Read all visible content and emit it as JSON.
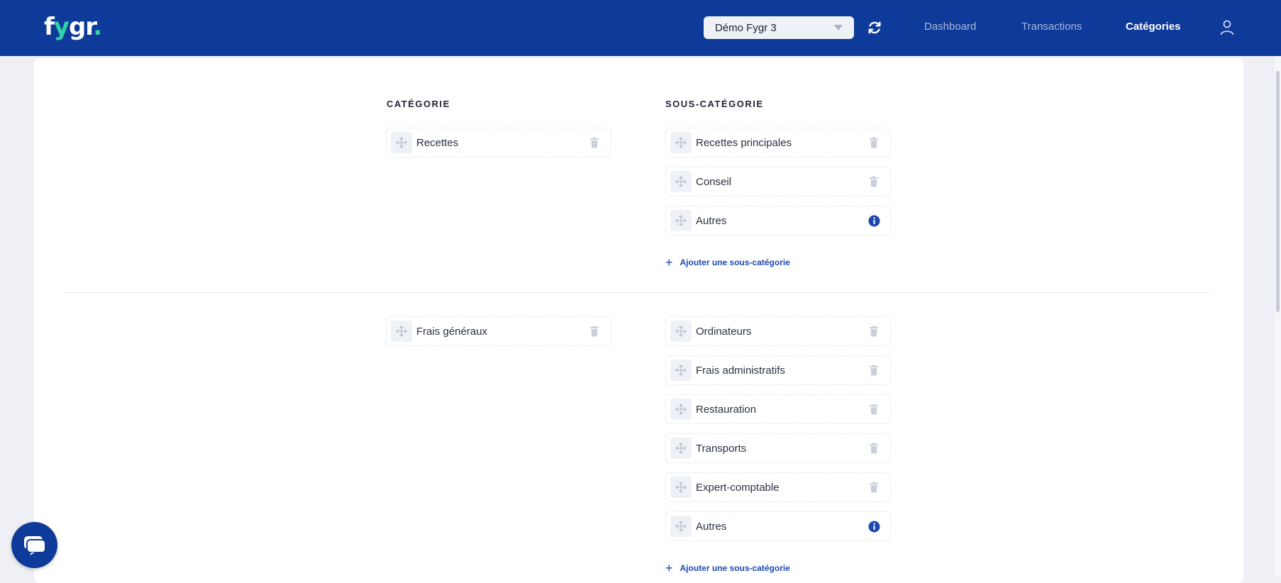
{
  "header": {
    "logo": {
      "f": "f",
      "y": "y",
      "gr": "gr",
      "dot": "."
    },
    "account_selector": {
      "value": "Démo Fygr 3"
    },
    "nav": {
      "dashboard": "Dashboard",
      "transactions": "Transactions",
      "categories": "Catégories"
    },
    "icons": [
      "refresh-icon",
      "user-icon",
      "chevron-down-icon"
    ],
    "brand_color": "#0e3a9a",
    "accent_color": "#2fd3a7"
  },
  "columns": {
    "category": "CATÉGORIE",
    "subcategory": "SOUS-CATÉGORIE"
  },
  "groups": [
    {
      "category": "Recettes",
      "subcategories": [
        "Recettes principales",
        "Conseil",
        "Autres"
      ],
      "add_label": "Ajouter une sous-catégorie"
    },
    {
      "category": "Frais généraux",
      "subcategories": [
        "Ordinateurs",
        "Frais administratifs",
        "Restauration",
        "Transports",
        "Expert-comptable",
        "Autres"
      ],
      "add_label": "Ajouter une sous-catégorie"
    }
  ],
  "icons": {
    "drag": "drag-handle-icon",
    "delete": "trash-icon",
    "info": "info-icon",
    "add": "plus-icon",
    "chat": "chat-icon"
  },
  "colors": {
    "info_blue": "#1b49b0",
    "trash_grey": "#c9cfdb"
  }
}
